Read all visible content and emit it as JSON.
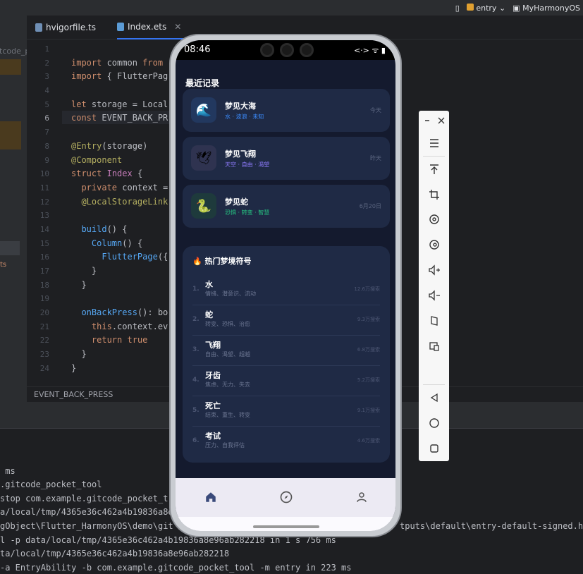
{
  "ide": {
    "top_right": {
      "module": "entry",
      "project": "MyHarmonyOS"
    },
    "sidebar": {
      "project_label": "itcode_p",
      "label": "ts"
    },
    "tabs": [
      {
        "label": "hvigorfile.ts",
        "active": false
      },
      {
        "label": "Index.ets",
        "active": true
      }
    ],
    "gutter": [
      "1",
      "2",
      "3",
      "4",
      "5",
      "6",
      "7",
      "8",
      "9",
      "10",
      "11",
      "12",
      "13",
      "14",
      "15",
      "16",
      "17",
      "18",
      "19",
      "20",
      "21",
      "22",
      "23",
      "24"
    ],
    "code_lines": [
      "",
      "import common from",
      "import { FlutterPag",
      "",
      "let storage = Local",
      "const EVENT_BACK_PR",
      "",
      "@Entry(storage)",
      "@Component",
      "struct Index {",
      "  private context =",
      "  @LocalStorageLink",
      "",
      "  build() {",
      "    Column() {",
      "      FlutterPage({",
      "    }",
      "  }",
      "",
      "  onBackPress(): bo",
      "    this.context.ev",
      "    return true",
      "  }",
      "}"
    ],
    "breadcrumb": "EVENT_BACK_PRESS",
    "console_lines": [
      " ms",
      ".gitcode_pocket_tool",
      "stop com.example.gitcode_pocket_t",
      "a/local/tmp/4365e36c462a4b19836a8e",
      "gObject\\Flutter_HarmonyOS\\demo\\git",
      "l -p data/local/tmp/4365e36c462a4b19836a8e96ab282218 in 1 s 756 ms",
      "ta/local/tmp/4365e36c462a4b19836a8e96ab282218",
      "-a EntryAbility -b com.example.gitcode_pocket_tool -m entry in 223 ms"
    ],
    "console_right": "tputs\\default\\entry-default-signed.ha"
  },
  "phone": {
    "status_time": "08:46",
    "status_icons": "<·> ᯤ ▮",
    "recent_title": "最近记录",
    "recent": [
      {
        "icon": "wave-icon",
        "glyph": "🌊",
        "name": "梦见大海",
        "tags": "水 · 波浪 · 未知",
        "date": "今天",
        "tag_color": "#3b8cff",
        "icon_bg": "#22385f"
      },
      {
        "icon": "bird-icon",
        "glyph": "🕊",
        "name": "梦见飞翔",
        "tags": "天空 · 自由 · 渴望",
        "date": "昨天",
        "tag_color": "#8f7cff",
        "icon_bg": "#2f3350"
      },
      {
        "icon": "snake-icon",
        "glyph": "🐍",
        "name": "梦见蛇",
        "tags": "恐惧 · 转变 · 智慧",
        "date": "6月20日",
        "tag_color": "#26c281",
        "icon_bg": "#1e3a3c"
      }
    ],
    "hot_title": "🔥 热门梦境符号",
    "hot": [
      {
        "rank": "1.",
        "word": "水",
        "desc": "情绪、潜意识、流动",
        "count": "12.6万搜索"
      },
      {
        "rank": "2.",
        "word": "蛇",
        "desc": "转变、恐惧、治愈",
        "count": "9.3万搜索"
      },
      {
        "rank": "3.",
        "word": "飞翔",
        "desc": "自由、渴望、超越",
        "count": "6.8万搜索"
      },
      {
        "rank": "4.",
        "word": "牙齿",
        "desc": "焦虑、无力、失去",
        "count": "5.2万搜索"
      },
      {
        "rank": "5.",
        "word": "死亡",
        "desc": "结束、重生、转变",
        "count": "9.1万搜索"
      },
      {
        "rank": "6.",
        "word": "考试",
        "desc": "压力、自我评估",
        "count": "4.6万搜索"
      }
    ],
    "nav": [
      "home-icon",
      "compass-icon",
      "person-icon"
    ]
  },
  "emulator_toolbar": [
    "minimize-icon",
    "close-icon",
    "menu-icon",
    "pin-top-icon",
    "crop-icon",
    "rotate-icon",
    "rotate-ccw-icon",
    "volume-up-icon",
    "volume-down-icon",
    "fold-icon",
    "screenshot-icon",
    "back-icon",
    "home-icon",
    "recents-icon"
  ],
  "colors": {
    "accent": "#3574f0",
    "screen_bg": "#141a2e",
    "card_bg": "#1f2a45"
  }
}
